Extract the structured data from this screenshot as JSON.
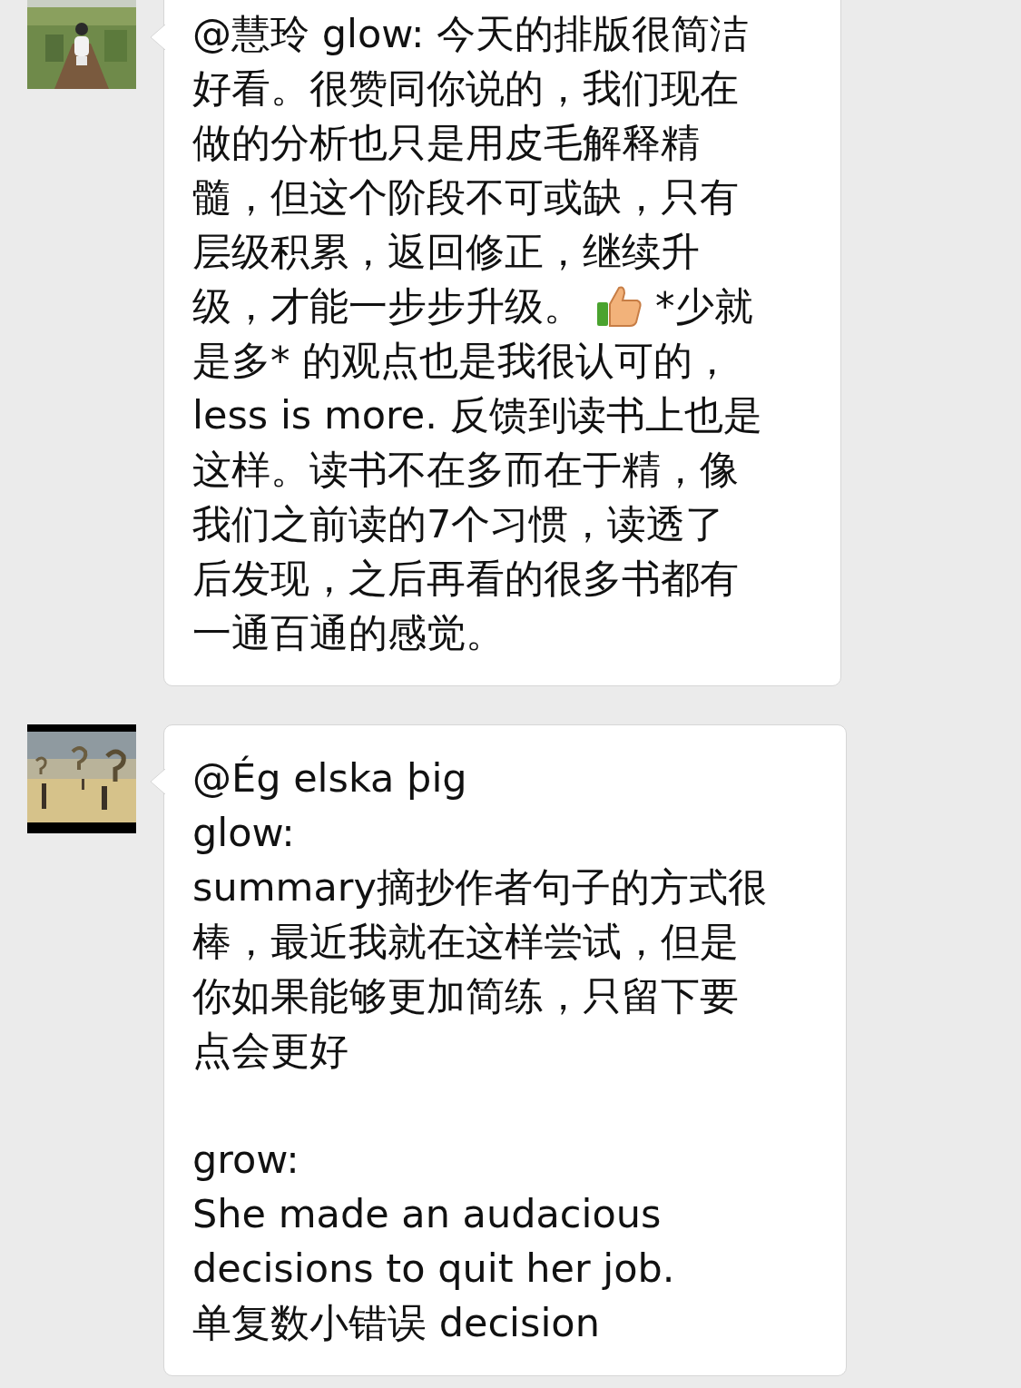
{
  "messages": [
    {
      "avatar": {
        "kind": "picture"
      },
      "paragraphs": [
        [
          [
            {
              "kind": "text",
              "text": "@慧玲 glow: 今天的排版很简洁"
            }
          ],
          [
            {
              "kind": "text",
              "text": "好看。很赞同你说的，我们现在"
            }
          ],
          [
            {
              "kind": "text",
              "text": "做的分析也只是用皮毛解释精"
            }
          ],
          [
            {
              "kind": "text",
              "text": "髓，但这个阶段不可或缺，只有"
            }
          ],
          [
            {
              "kind": "text",
              "text": "层级积累，返回修正，继续升"
            }
          ],
          [
            {
              "kind": "text",
              "text": "级，才能一步步升级。"
            },
            {
              "kind": "emoji"
            },
            {
              "kind": "text",
              "text": "*少就"
            }
          ],
          [
            {
              "kind": "text",
              "text": "是多* 的观点也是我很认可的，"
            }
          ],
          [
            {
              "kind": "text",
              "text": "less is more. 反馈到读书上也是"
            }
          ],
          [
            {
              "kind": "text",
              "text": "这样。读书不在多而在于精，像"
            }
          ],
          [
            {
              "kind": "text",
              "text": "我们之前读的7个习惯，读透了"
            }
          ],
          [
            {
              "kind": "text",
              "text": "后发现，之后再看的很多书都有"
            }
          ],
          [
            {
              "kind": "text",
              "text": "一通百通的感觉。"
            }
          ]
        ]
      ]
    },
    {
      "avatar": {
        "kind": "picture"
      },
      "paragraphs": [
        [
          [
            {
              "kind": "text",
              "text": "@Ég elska þig"
            }
          ],
          [
            {
              "kind": "text",
              "text": "glow:"
            }
          ],
          [
            {
              "kind": "text",
              "text": "summary摘抄作者句子的方式很"
            }
          ],
          [
            {
              "kind": "text",
              "text": "棒，最近我就在这样尝试，但是"
            }
          ],
          [
            {
              "kind": "text",
              "text": "你如果能够更加简练，只留下要"
            }
          ],
          [
            {
              "kind": "text",
              "text": "点会更好"
            }
          ]
        ],
        [
          [
            {
              "kind": "text",
              "text": "grow:"
            }
          ],
          [
            {
              "kind": "text",
              "text": "She made an audacious"
            }
          ],
          [
            {
              "kind": "text",
              "text": "decisions to quit her job."
            }
          ],
          [
            {
              "kind": "text",
              "text": "单复数小错误 decision"
            }
          ]
        ]
      ]
    }
  ]
}
